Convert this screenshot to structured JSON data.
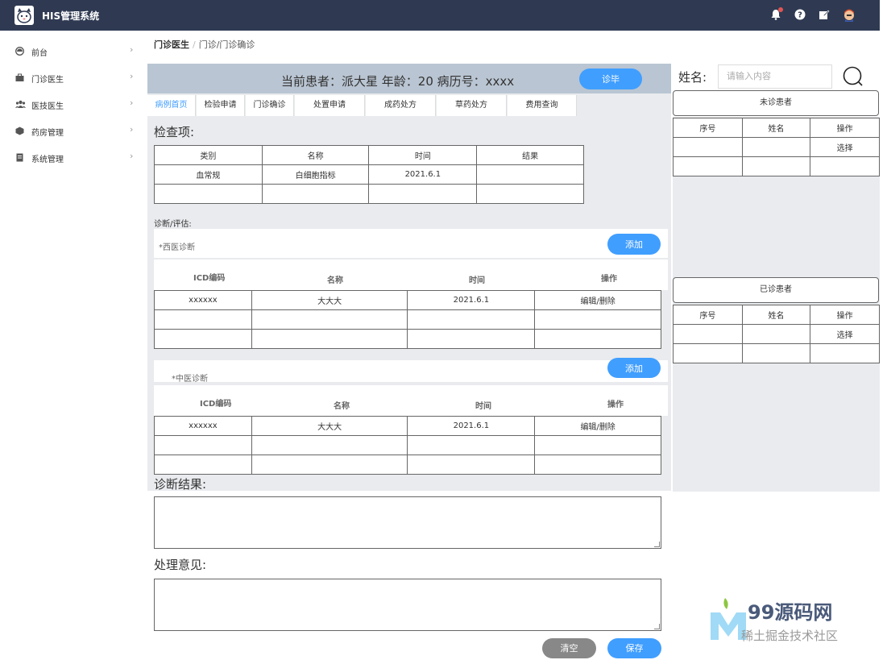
{
  "app": {
    "title": "HIS管理系统"
  },
  "sidebar": {
    "items": [
      {
        "label": "前台",
        "icon": "dashboard-icon"
      },
      {
        "label": "门诊医生",
        "icon": "briefcase-icon"
      },
      {
        "label": "医技医生",
        "icon": "users-icon"
      },
      {
        "label": "药房管理",
        "icon": "box-icon"
      },
      {
        "label": "系统管理",
        "icon": "document-icon"
      }
    ]
  },
  "breadcrumb": {
    "root": "门诊医生",
    "separator": "/",
    "rest": "门诊/门诊确诊"
  },
  "patient": {
    "info": "当前患者：派大星  年龄：20  病历号：xxxx",
    "finish_button": "诊毕"
  },
  "tabs": [
    "病例首页",
    "检验申请",
    "门诊确诊",
    "处置申请",
    "成药处方",
    "草药处方",
    "费用查询"
  ],
  "exam": {
    "title": "检查项:",
    "headers": [
      "类别",
      "名称",
      "时间",
      "结果"
    ],
    "rows": [
      [
        "血常规",
        "白细胞指标",
        "2021.6.1",
        ""
      ],
      [
        "",
        "",
        "",
        ""
      ]
    ]
  },
  "diagnosis": {
    "label": "诊断/评估:",
    "western": {
      "title": "*西医诊断",
      "add_button": "添加",
      "headers": [
        "ICD编码",
        "名称",
        "时间",
        "操作"
      ],
      "rows": [
        [
          "xxxxxx",
          "大大大",
          "2021.6.1",
          "编辑/删除"
        ],
        [
          "",
          "",
          "",
          ""
        ],
        [
          "",
          "",
          "",
          ""
        ]
      ]
    },
    "chinese": {
      "title": "*中医诊断",
      "add_button": "添加",
      "headers": [
        "ICD编码",
        "名称",
        "时间",
        "操作"
      ],
      "rows": [
        [
          "xxxxxx",
          "大大大",
          "2021.6.1",
          "编辑/删除"
        ],
        [
          "",
          "",
          "",
          ""
        ],
        [
          "",
          "",
          "",
          ""
        ]
      ]
    }
  },
  "result": {
    "label": "诊断结果:"
  },
  "opinion": {
    "label": "处理意见:"
  },
  "actions": {
    "clear": "清空",
    "save": "保存"
  },
  "right": {
    "name_label": "姓名:",
    "search_placeholder": "请输入内容",
    "pending": {
      "title": "未诊患者",
      "headers": [
        "序号",
        "姓名",
        "操作"
      ],
      "rows": [
        [
          "",
          "",
          "选择"
        ],
        [
          "",
          "",
          ""
        ]
      ]
    },
    "done": {
      "title": "已诊患者",
      "headers": [
        "序号",
        "姓名",
        "操作"
      ],
      "rows": [
        [
          "",
          "",
          "选择"
        ],
        [
          "",
          "",
          ""
        ]
      ]
    }
  },
  "watermark": {
    "brand": "99源码网",
    "sub": "稀土掘金技术社区"
  },
  "colors": {
    "topbar": "#2f3a52",
    "accent": "#409eff",
    "panel": "#e9ebee",
    "patient_bar": "#b9c5d2"
  }
}
